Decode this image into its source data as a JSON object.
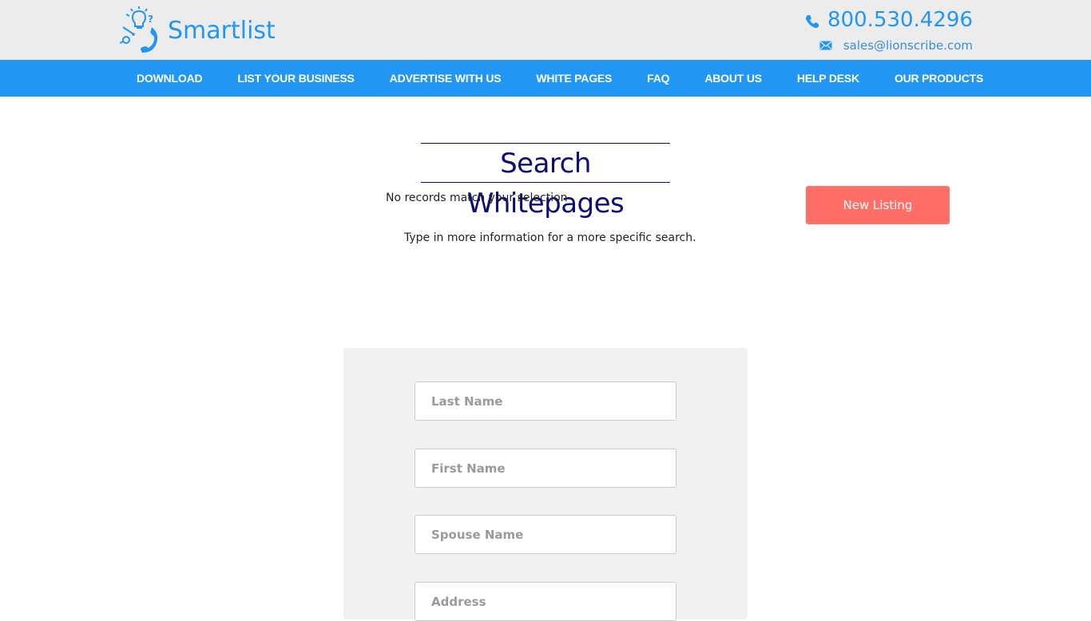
{
  "header": {
    "logo_text": "Smartlist",
    "logo_icon": "phone-lightbulb-logo-icon",
    "phone": "800.530.4296",
    "phone_icon": "phone-icon",
    "email": "sales@lionscribe.com",
    "email_icon": "mail-icon"
  },
  "nav": {
    "items": [
      {
        "label": "DOWNLOAD"
      },
      {
        "label": "LIST YOUR BUSINESS"
      },
      {
        "label": "ADVERTISE WITH US"
      },
      {
        "label": "WHITE PAGES"
      },
      {
        "label": "FAQ"
      },
      {
        "label": "ABOUT US"
      },
      {
        "label": "HELP DESK"
      },
      {
        "label": "OUR PRODUCTS"
      }
    ]
  },
  "main": {
    "title": "Search Whitepages",
    "no_records": "No records match your selection",
    "hint": "Type in more information for a more specific search.",
    "new_listing_label": "New Listing"
  },
  "form": {
    "fields": [
      {
        "placeholder": "Last Name",
        "value": ""
      },
      {
        "placeholder": "First Name",
        "value": ""
      },
      {
        "placeholder": "Spouse Name",
        "value": ""
      },
      {
        "placeholder": "Address",
        "value": ""
      }
    ]
  },
  "colors": {
    "brand_blue": "#2196f3",
    "title_navy": "#0d0d7a",
    "button_coral": "#ff6f68",
    "topbar_gray": "#ececec",
    "panel_gray": "#f1f1f1"
  }
}
